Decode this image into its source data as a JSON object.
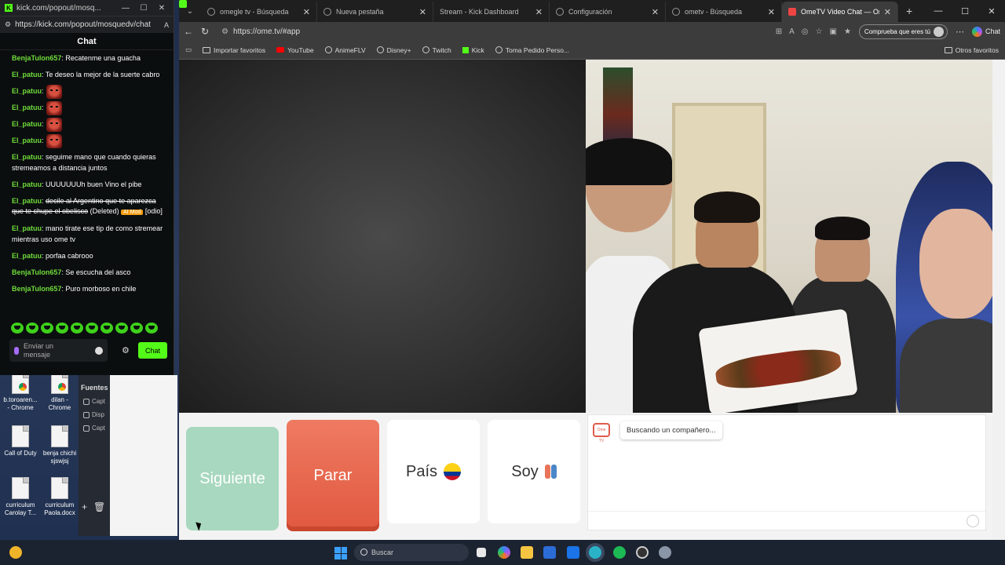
{
  "kick_window": {
    "url": "kick.com/popout/mosq...",
    "address": "https://kick.com/popout/mosquedv/chat",
    "chat_header": "Chat",
    "messages": [
      {
        "user": "BenjaTulon657",
        "text": "Recatenme una guacha",
        "type": "text"
      },
      {
        "user": "El_patuu",
        "text": "Te deseo la mejor de la suerte cabro",
        "type": "text"
      },
      {
        "user": "El_patuu",
        "text": "",
        "type": "emote"
      },
      {
        "user": "El_patuu",
        "text": "",
        "type": "emote"
      },
      {
        "user": "El_patuu",
        "text": "",
        "type": "emote"
      },
      {
        "user": "El_patuu",
        "text": "",
        "type": "emote"
      },
      {
        "user": "El_patuu",
        "text": "seguime mano que cuando quieras stremeamos a distancia juntos",
        "type": "text"
      },
      {
        "user": "El_patuu",
        "text": "UUUUUUUh buen Vino el pibe",
        "type": "text"
      },
      {
        "user": "El_patuu",
        "text": "decile al Argentino que te aparezca que te chupe el obelisco",
        "type": "deleted",
        "deleted_label": "(Deleted)",
        "badge": "AI Mod",
        "reason": "[odio]"
      },
      {
        "user": "El_patuu",
        "text": "mano tirate ese tip de como stremear mientras uso ome tv",
        "type": "text"
      },
      {
        "user": "El_patuu",
        "text": "porfaa cabrooo",
        "type": "text"
      },
      {
        "user": "BenjaTulon657",
        "text": "Se escucha del asco",
        "type": "text"
      },
      {
        "user": "BenjaTulon657",
        "text": "Puro morboso en chile",
        "type": "text"
      }
    ],
    "input_placeholder": "Enviar un mensaje",
    "send_label": "Chat"
  },
  "desktop": {
    "icons": [
      {
        "label": "b.toroaren... - Chrome",
        "kind": "chrome"
      },
      {
        "label": "dilan - Chrome",
        "kind": "chrome"
      },
      {
        "label": "Call of Duty",
        "kind": "file"
      },
      {
        "label": "benja chichi sjswjsj",
        "kind": "file"
      },
      {
        "label": "curriculum Carolay T...",
        "kind": "file"
      },
      {
        "label": "curriculum Paola.docx",
        "kind": "file"
      }
    ],
    "obs": {
      "title": "Fuentes",
      "rows": [
        "Capt",
        "Disp",
        "Capt"
      ]
    }
  },
  "browser": {
    "tabs": [
      {
        "label": "omegle tv - Búsqueda",
        "icon": "search-icon",
        "active": false
      },
      {
        "label": "Nueva pestaña",
        "icon": "page-icon",
        "active": false
      },
      {
        "label": "Stream - Kick Dashboard",
        "icon": "kick-icon",
        "active": false
      },
      {
        "label": "Configuración",
        "icon": "gear-icon",
        "active": false
      },
      {
        "label": "ometv - Búsqueda",
        "icon": "search-icon",
        "active": false
      },
      {
        "label": "OmeTV Video Chat — On",
        "icon": "ometv-icon",
        "active": true
      }
    ],
    "url": "https://ome.tv/#app",
    "profile_label": "Comprueba que eres tú",
    "copilot_label": "Chat",
    "bookmarks": [
      {
        "label": "Importar favoritos",
        "icon": "folder"
      },
      {
        "label": "YouTube",
        "icon": "youtube"
      },
      {
        "label": "AnimeFLV",
        "icon": "globe"
      },
      {
        "label": "Disney+",
        "icon": "globe"
      },
      {
        "label": "Twitch",
        "icon": "globe"
      },
      {
        "label": "Kick",
        "icon": "kick"
      },
      {
        "label": "Toma Pedido Perso...",
        "icon": "globe"
      }
    ],
    "other_bookmarks": "Otros favoritos"
  },
  "ometv": {
    "next_label": "Siguiente",
    "stop_label": "Parar",
    "country_label": "País",
    "gender_label": "Soy",
    "status_message": "Buscando un compañero...",
    "logo_text": "Ome TV"
  },
  "taskbar": {
    "search_placeholder": "Buscar"
  }
}
